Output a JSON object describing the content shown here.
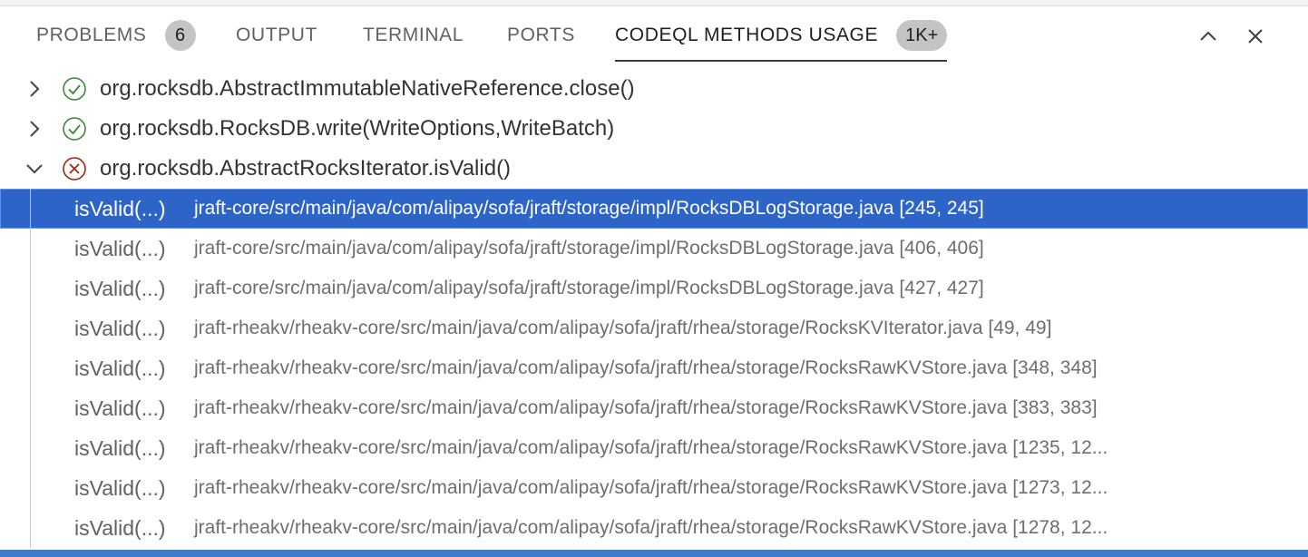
{
  "panel": {
    "tabs": [
      {
        "label": "PROBLEMS",
        "badge": "6"
      },
      {
        "label": "OUTPUT"
      },
      {
        "label": "TERMINAL"
      },
      {
        "label": "PORTS"
      },
      {
        "label": "CODEQL METHODS USAGE",
        "badge": "1K+"
      }
    ],
    "active_tab": "CODEQL METHODS USAGE",
    "actions": {
      "maximize_icon": "chevron-up-icon",
      "close_icon": "close-icon"
    }
  },
  "tree": {
    "methods": [
      {
        "name": "org.rocksdb.AbstractImmutableNativeReference.close()",
        "status": "supported",
        "expanded": false
      },
      {
        "name": "org.rocksdb.RocksDB.write(WriteOptions,WriteBatch)",
        "status": "supported",
        "expanded": false
      },
      {
        "name": "org.rocksdb.AbstractRocksIterator.isValid()",
        "status": "unsupported",
        "expanded": true
      }
    ],
    "usages": [
      {
        "label": "isValid(...)",
        "location": "jraft-core/src/main/java/com/alipay/sofa/jraft/storage/impl/RocksDBLogStorage.java [245, 245]",
        "selected": true
      },
      {
        "label": "isValid(...)",
        "location": "jraft-core/src/main/java/com/alipay/sofa/jraft/storage/impl/RocksDBLogStorage.java [406, 406]"
      },
      {
        "label": "isValid(...)",
        "location": "jraft-core/src/main/java/com/alipay/sofa/jraft/storage/impl/RocksDBLogStorage.java [427, 427]"
      },
      {
        "label": "isValid(...)",
        "location": "jraft-rheakv/rheakv-core/src/main/java/com/alipay/sofa/jraft/rhea/storage/RocksKVIterator.java [49, 49]"
      },
      {
        "label": "isValid(...)",
        "location": "jraft-rheakv/rheakv-core/src/main/java/com/alipay/sofa/jraft/rhea/storage/RocksRawKVStore.java [348, 348]"
      },
      {
        "label": "isValid(...)",
        "location": "jraft-rheakv/rheakv-core/src/main/java/com/alipay/sofa/jraft/rhea/storage/RocksRawKVStore.java [383, 383]"
      },
      {
        "label": "isValid(...)",
        "location": "jraft-rheakv/rheakv-core/src/main/java/com/alipay/sofa/jraft/rhea/storage/RocksRawKVStore.java [1235, 12..."
      },
      {
        "label": "isValid(...)",
        "location": "jraft-rheakv/rheakv-core/src/main/java/com/alipay/sofa/jraft/rhea/storage/RocksRawKVStore.java [1273, 12..."
      },
      {
        "label": "isValid(...)",
        "location": "jraft-rheakv/rheakv-core/src/main/java/com/alipay/sofa/jraft/rhea/storage/RocksRawKVStore.java [1278, 12..."
      }
    ]
  },
  "colors": {
    "selection": "#2d64c8",
    "supported": "#388a34",
    "unsupported": "#a1260d",
    "statusbar": "#3c7ccf"
  }
}
